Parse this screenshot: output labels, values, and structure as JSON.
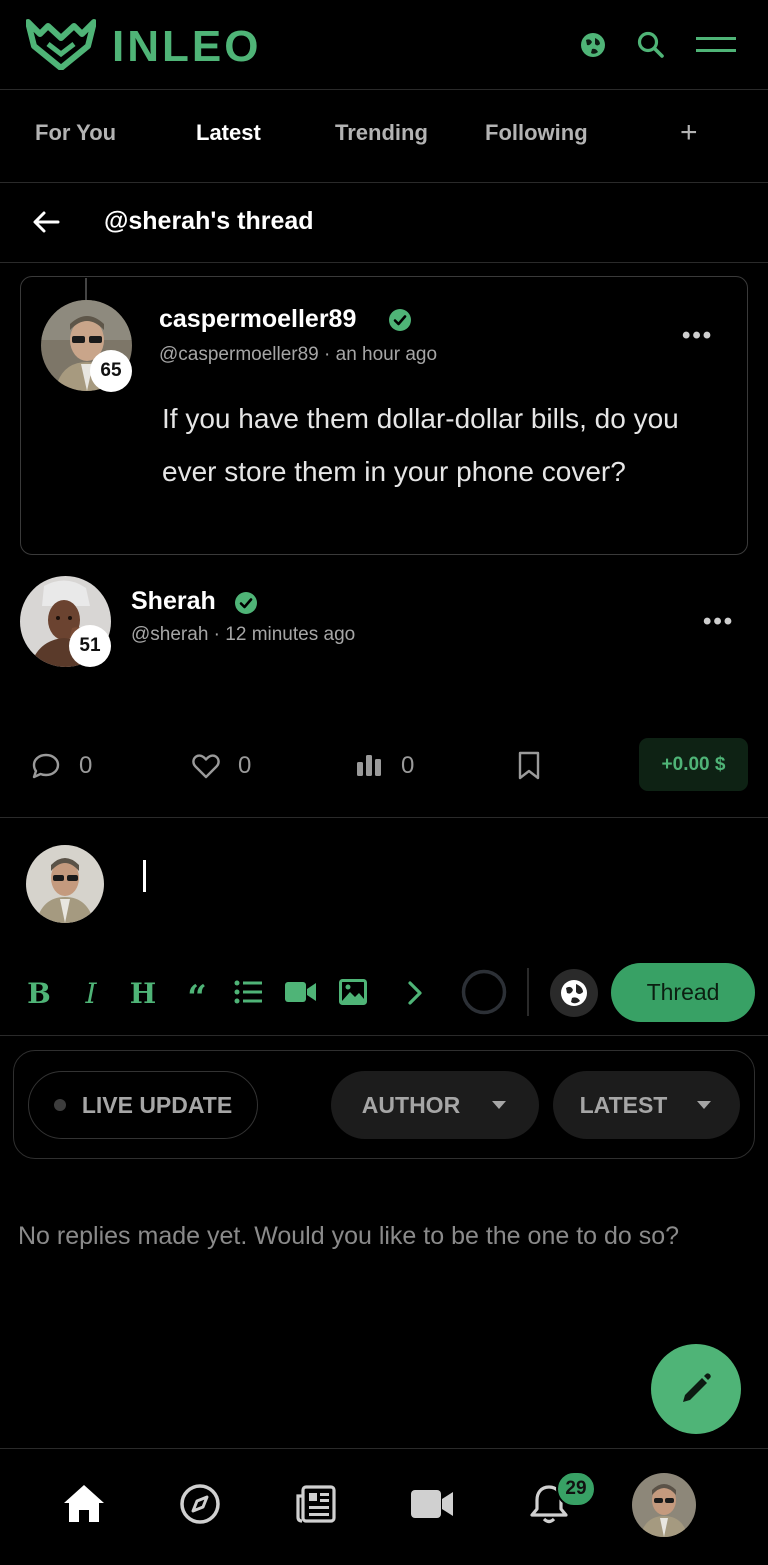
{
  "app": {
    "brand": "INLEO",
    "accent": "#4fb477"
  },
  "tabs": [
    {
      "label": "For You"
    },
    {
      "label": "Latest"
    },
    {
      "label": "Trending"
    },
    {
      "label": "Following"
    },
    {
      "label": "+"
    }
  ],
  "thread": {
    "title": "@sherah's thread"
  },
  "parent_post": {
    "author": "caspermoeller89",
    "handle": "@caspermoeller89",
    "time": "an hour ago",
    "reputation": "65",
    "verified": true,
    "body": "If you have them dollar-dollar bills, do you ever store them in your phone cover?"
  },
  "reply_post": {
    "author": "Sherah",
    "handle": "@sherah",
    "time": "12 minutes ago",
    "reputation": "51",
    "verified": true,
    "actions": {
      "comments": "0",
      "likes": "0",
      "views": "0",
      "earnings": "+0.00 $"
    }
  },
  "composer": {
    "toolbar": [
      "bold-icon",
      "italic-icon",
      "heading-icon",
      "quote-icon",
      "list-icon",
      "video-icon",
      "image-icon",
      "chevron-right-icon"
    ],
    "submit_label": "Thread"
  },
  "filters": {
    "live": "LIVE UPDATE",
    "author": "AUTHOR",
    "sort": "LATEST"
  },
  "empty_message": "No replies made yet. Would you like to be the one to do so?",
  "bottom_nav": {
    "notifications_count": "29"
  }
}
